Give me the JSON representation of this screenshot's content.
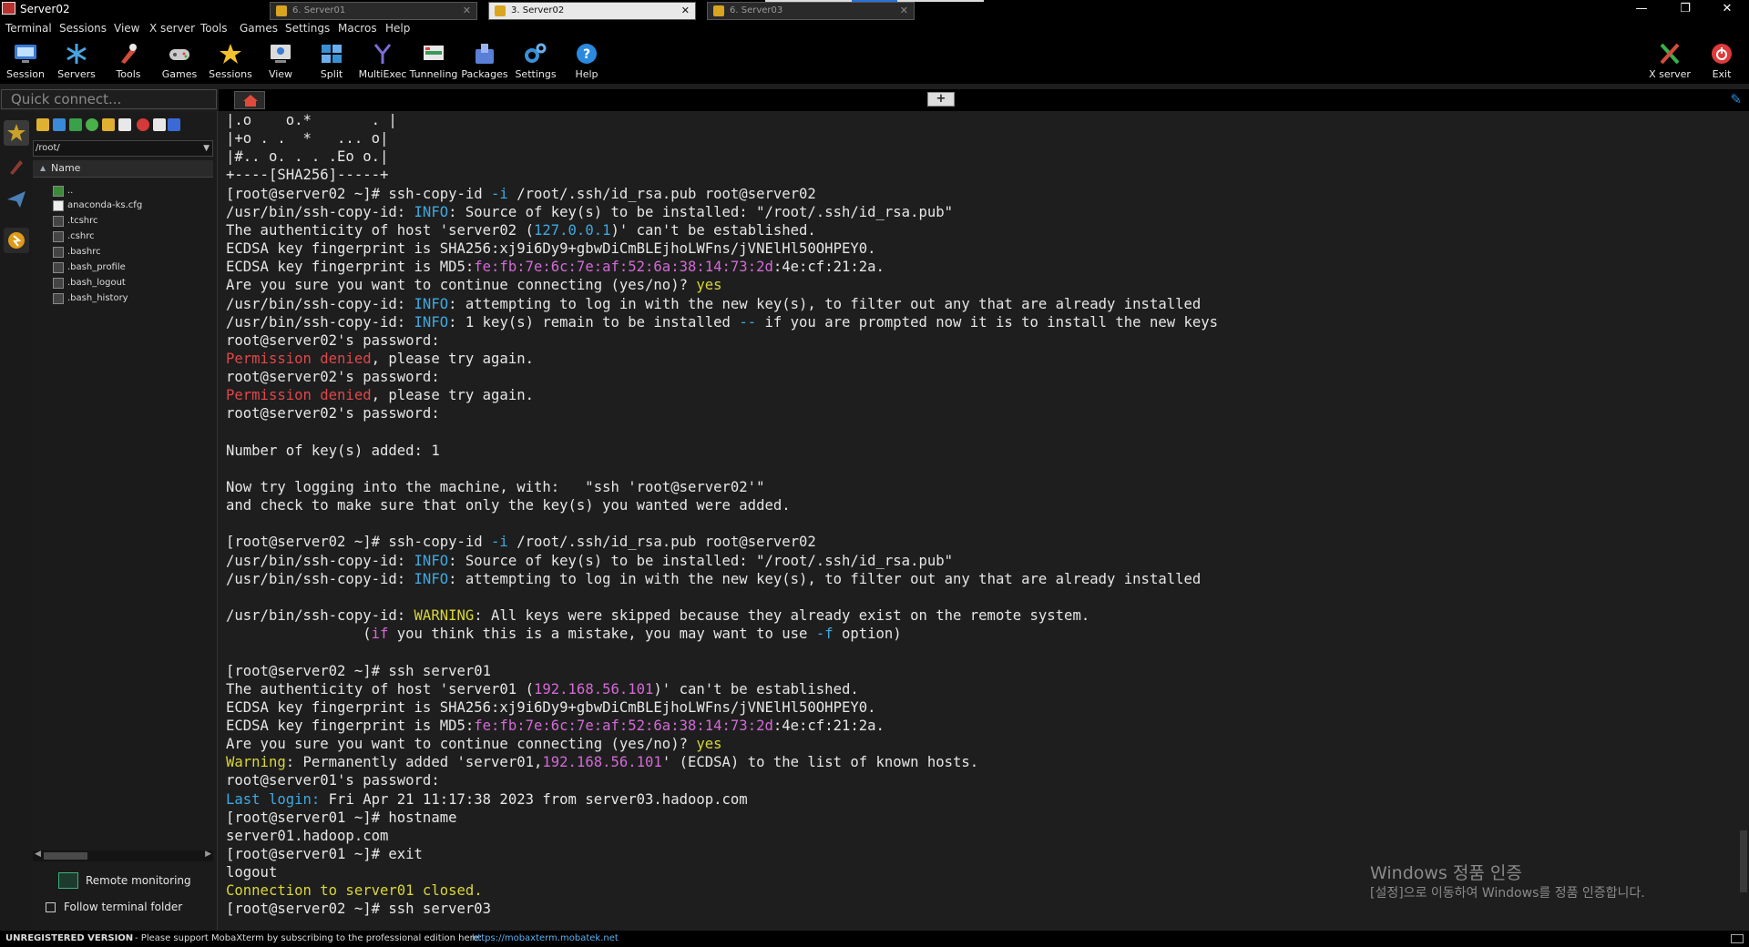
{
  "window": {
    "title": "Server02",
    "controls": [
      "—",
      "❐",
      "✕"
    ]
  },
  "menu": [
    "Terminal",
    "Sessions",
    "View",
    "X server",
    "Tools",
    "Games",
    "Settings",
    "Macros",
    "Help"
  ],
  "toolbar": {
    "buttons": [
      {
        "label": "Session",
        "icon": "session-icon",
        "color": "#3a7bd5"
      },
      {
        "label": "Servers",
        "icon": "servers-icon",
        "color": "#4aa3df"
      },
      {
        "label": "Tools",
        "icon": "tools-icon",
        "color": "#d44c3a"
      },
      {
        "label": "Games",
        "icon": "games-icon",
        "color": "#cccccc"
      },
      {
        "label": "Sessions",
        "icon": "star-icon",
        "color": "#f2c12e"
      },
      {
        "label": "View",
        "icon": "view-icon",
        "color": "#3a7bd5"
      },
      {
        "label": "Split",
        "icon": "split-icon",
        "color": "#3a8fd5"
      },
      {
        "label": "MultiExec",
        "icon": "multiexec-icon",
        "color": "#7a6fd6"
      },
      {
        "label": "Tunneling",
        "icon": "tunneling-icon",
        "color": "#3a9a5a"
      },
      {
        "label": "Packages",
        "icon": "packages-icon",
        "color": "#5a7fd6"
      },
      {
        "label": "Settings",
        "icon": "settings-icon",
        "color": "#3a8fd5"
      },
      {
        "label": "Help",
        "icon": "help-icon",
        "color": "#2a8ae0"
      }
    ],
    "right": [
      {
        "label": "X server",
        "icon": "xserver-icon",
        "color": "#3ab04a"
      },
      {
        "label": "Exit",
        "icon": "power-icon",
        "color": "#e03a3a"
      }
    ]
  },
  "quick_connect": {
    "placeholder": "Quick connect..."
  },
  "tabs": [
    {
      "label": "6. Server01",
      "active": false
    },
    {
      "label": "3. Server02",
      "active": true
    },
    {
      "label": "6. Server03",
      "active": false
    }
  ],
  "sftp": {
    "path": "/root/",
    "column": "Name",
    "files": [
      "..",
      "anaconda-ks.cfg",
      ".tcshrc",
      ".cshrc",
      ".bashrc",
      ".bash_profile",
      ".bash_logout",
      ".bash_history"
    ],
    "remote_monitoring": "Remote monitoring",
    "follow_folder": "Follow terminal folder"
  },
  "terminal": {
    "lines": [
      [
        [
          "|.o    o.*       . |",
          "w"
        ]
      ],
      [
        [
          "|+o . .  *   ... o|",
          "w"
        ]
      ],
      [
        [
          "|#.. o. . . .Eo o.|",
          "w"
        ]
      ],
      [
        [
          "+----[SHA256]-----+",
          "w"
        ]
      ],
      [
        [
          "[root@server02 ~]# ssh-copy-id ",
          "w"
        ],
        [
          "-i",
          "c"
        ],
        [
          " /root/.ssh/id_rsa.pub root@server02",
          "w"
        ]
      ],
      [
        [
          "/usr/bin/ssh-copy-id: ",
          "w"
        ],
        [
          "INFO",
          "c"
        ],
        [
          ": Source of key(s) to be installed: \"/root/.ssh/id_rsa.pub\"",
          "w"
        ]
      ],
      [
        [
          "The authenticity of host 'server02 (",
          "w"
        ],
        [
          "127.0.0.1",
          "c"
        ],
        [
          ")' can't be established.",
          "w"
        ]
      ],
      [
        [
          "ECDSA key fingerprint is SHA256:xj9i6Dy9+gbwDiCmBLEjhoLWFns/jVNElHl50OHPEY0.",
          "w"
        ]
      ],
      [
        [
          "ECDSA key fingerprint is MD5:",
          "w"
        ],
        [
          "fe:fb:7e:6c:7e:af:52:6a:38:14:73:2d",
          "m"
        ],
        [
          ":4e:cf:21:2a.",
          "w"
        ]
      ],
      [
        [
          "Are you sure you want to continue connecting (yes/no)? ",
          "w"
        ],
        [
          "yes",
          "y"
        ]
      ],
      [
        [
          "/usr/bin/ssh-copy-id: ",
          "w"
        ],
        [
          "INFO",
          "c"
        ],
        [
          ": attempting to log in with the new key(s), to filter out any that are already installed",
          "w"
        ]
      ],
      [
        [
          "/usr/bin/ssh-copy-id: ",
          "w"
        ],
        [
          "INFO",
          "c"
        ],
        [
          ": 1 key(s) remain to be installed ",
          "w"
        ],
        [
          "--",
          "c"
        ],
        [
          " if you are prompted now it is to install the new keys",
          "w"
        ]
      ],
      [
        [
          "root@server02's password:",
          "w"
        ]
      ],
      [
        [
          "Permission denied",
          "r"
        ],
        [
          ", please try again.",
          "w"
        ]
      ],
      [
        [
          "root@server02's password:",
          "w"
        ]
      ],
      [
        [
          "Permission denied",
          "r"
        ],
        [
          ", please try again.",
          "w"
        ]
      ],
      [
        [
          "root@server02's password:",
          "w"
        ]
      ],
      [],
      [
        [
          "Number of key(s) added: 1",
          "w"
        ]
      ],
      [],
      [
        [
          "Now try logging into the machine, with:   \"ssh 'root@server02'\"",
          "w"
        ]
      ],
      [
        [
          "and check to make sure that only the key(s) you wanted were added.",
          "w"
        ]
      ],
      [],
      [
        [
          "[root@server02 ~]# ssh-copy-id ",
          "w"
        ],
        [
          "-i",
          "c"
        ],
        [
          " /root/.ssh/id_rsa.pub root@server02",
          "w"
        ]
      ],
      [
        [
          "/usr/bin/ssh-copy-id: ",
          "w"
        ],
        [
          "INFO",
          "c"
        ],
        [
          ": Source of key(s) to be installed: \"/root/.ssh/id_rsa.pub\"",
          "w"
        ]
      ],
      [
        [
          "/usr/bin/ssh-copy-id: ",
          "w"
        ],
        [
          "INFO",
          "c"
        ],
        [
          ": attempting to log in with the new key(s), to filter out any that are already installed",
          "w"
        ]
      ],
      [],
      [
        [
          "/usr/bin/ssh-copy-id: ",
          "w"
        ],
        [
          "WARNING",
          "y"
        ],
        [
          ": All keys were skipped because they already exist on the remote system.",
          "w"
        ]
      ],
      [
        [
          "                (",
          "w"
        ],
        [
          "if",
          "m"
        ],
        [
          " you think this is a mistake, you may want to use ",
          "w"
        ],
        [
          "-f",
          "c"
        ],
        [
          " option)",
          "w"
        ]
      ],
      [],
      [
        [
          "[root@server02 ~]# ssh server01",
          "w"
        ]
      ],
      [
        [
          "The authenticity of host 'server01 (",
          "w"
        ],
        [
          "192.168.56.101",
          "m"
        ],
        [
          ")' can't be established.",
          "w"
        ]
      ],
      [
        [
          "ECDSA key fingerprint is SHA256:xj9i6Dy9+gbwDiCmBLEjhoLWFns/jVNElHl50OHPEY0.",
          "w"
        ]
      ],
      [
        [
          "ECDSA key fingerprint is MD5:",
          "w"
        ],
        [
          "fe:fb:7e:6c:7e:af:52:6a:38:14:73:2d",
          "m"
        ],
        [
          ":4e:cf:21:2a.",
          "w"
        ]
      ],
      [
        [
          "Are you sure you want to continue connecting (yes/no)? ",
          "w"
        ],
        [
          "yes",
          "y"
        ]
      ],
      [
        [
          "Warning",
          "y"
        ],
        [
          ": Permanently added 'server01,",
          "w"
        ],
        [
          "192.168.56.101",
          "m"
        ],
        [
          "' (ECDSA) to the list of known hosts.",
          "w"
        ]
      ],
      [
        [
          "root@server01's password:",
          "w"
        ]
      ],
      [
        [
          "Last login:",
          "c"
        ],
        [
          " Fri Apr 21 11:17:38 2023 from server03.hadoop.com",
          "w"
        ]
      ],
      [
        [
          "[root@server01 ~]# hostname",
          "w"
        ]
      ],
      [
        [
          "server01.hadoop.com",
          "w"
        ]
      ],
      [
        [
          "[root@server01 ~]# exit",
          "w"
        ]
      ],
      [
        [
          "logout",
          "w"
        ]
      ],
      [
        [
          "Connection to server01 closed.",
          "y"
        ]
      ],
      [
        [
          "[root@server02 ~]# ssh server03",
          "w"
        ]
      ]
    ]
  },
  "watermark": {
    "line1": "Windows 정품 인증",
    "line2": "[설정]으로 이동하여 Windows를 정품 인증합니다."
  },
  "status": {
    "left": "UNREGISTERED VERSION",
    "middle": "-  Please support MobaXterm by subscribing to the professional edition here:",
    "link": "https://mobaxterm.mobatek.net"
  }
}
